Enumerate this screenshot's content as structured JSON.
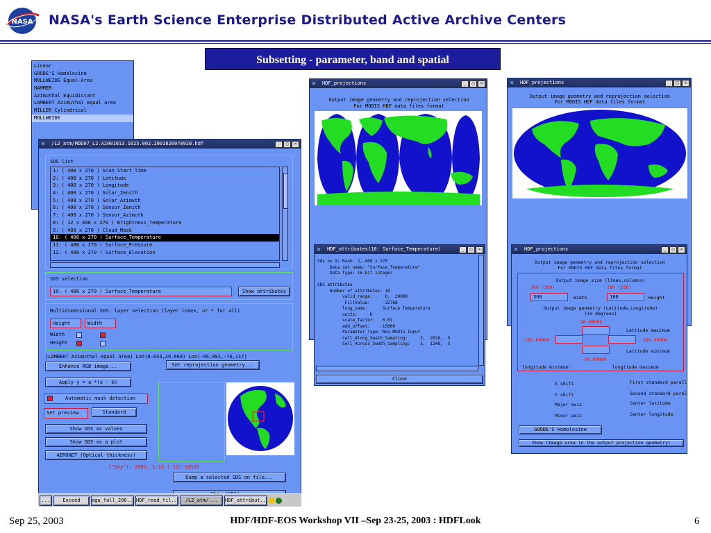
{
  "header": {
    "title": "NASA's Earth Science Enterprise Distributed Active Archive Centers",
    "logo_text": "NASA",
    "banner": "Subsetting - parameter, band and spatial"
  },
  "proj_list": {
    "items": [
      "Linear",
      "GOODE'S Homolosine",
      "MOLLWEIDE Equal-Area",
      "HAMMER",
      "Azimuthal Equidistant",
      "LAMBERT Azimuthal equal area",
      "MILLER Cylindrical",
      "MOLLWEIDE"
    ]
  },
  "main_window": {
    "title": "/L2_atm/MOD07_L2.A2001013.1625.002.2001026070928.hdf",
    "sds_list_label": "SDS  list",
    "sds_items": [
      "1: (  408 x  270 ) Scan_Start_Time",
      "2: (  408 x  270 ) Latitude",
      "3: (  408 x  270 ) Longitude",
      "4: (  408 x  270 ) Solar_Zenith",
      "5: (  408 x  270 ) Solar_Azimuth",
      "6: (  408 x  270 ) Sensor_Zenith",
      "7: (  408 x  270 ) Sensor_Azimuth",
      "8: (   12 x 408 x  270 ) Brightness_Temperature",
      "9: (  408 x  270 ) Cloud_Mask",
      "10: (  408 x  270 ) Surface_Temperature",
      "11: (  408 x  270 ) Surface_Pressure",
      "12: (  408 x  270 ) Surface_Elevation"
    ],
    "sds_selection_label": "SDS  selection",
    "sds_selection_value": "10: (  408 x  270 ) Surface_Temperature",
    "show_attributes": "Show attributes",
    "multidim_label": "Multidimensional SDS: layer selection (layer index, or * for all)",
    "height_field": "Height",
    "width_field": "Width",
    "width_row": "Width",
    "height_row": "Height",
    "lambert_line": "(LAMBERT Azimuthal equal area) Lat(8.653,29.669) Lon(-95,991,-70,117)",
    "enhance_btn": "Enhance RGB image...",
    "reprojection_btn": "Set reprojection geometry...",
    "apply_btn": "Apply   y = a *(x - b)",
    "auto_mask": "Automatic mask detection",
    "set_preview": "Set preview",
    "standard_btn": "Standard",
    "show_values": "Show SDS as values",
    "show_plot": "Show SDS as a plot",
    "aeronet": "AERONET (Optical thickness)",
    "day_line": "(\"Day\"): 2001: 1:13 ( 13) 16h25",
    "dump_btn": "Dump a selected SDS on file...",
    "more_btn": "Show (SDS)..."
  },
  "hdf_proj_1": {
    "title": "HDF_projections",
    "caption1": "Output image geometry and reprojection selection",
    "caption2": "For MODIS HDF data files format"
  },
  "hdf_proj_2": {
    "title": "HDF_projections",
    "caption1": "Output image geometry and reprojection selection",
    "caption2": "For MODIS HDF data files format"
  },
  "attr_window": {
    "title": "HDF_attributes(10: Surface_Temperature)",
    "lines": [
      "Sds no 9; Rank: 2, 408 x 270",
      "     Data set name: \"Surface_Temperature\"",
      "     Data type: 16-bit integer",
      "",
      "SDS attributes",
      "     Number of attributes: 10",
      "          valid_range:     0,  20000",
      "          _FillValue:     -32768",
      "          long_name:      Surface Temperature",
      "          units:     K",
      "          scale_factor:   0.01",
      "          add_offset:    -15000",
      "          Parameter_Type: Non MODIS Input",
      "          Cell_Along_Swath_Sampling:     3,  2028,  5",
      "          Cell_Across_Swath_Sampling:    3,  1348,  5"
    ],
    "close_btn": "Close"
  },
  "hdf_proj_3": {
    "title": "HDF_projections",
    "caption1": "Output image geometry and reprojection selection",
    "caption2": "For MODIS HDF data files format",
    "size_label": "Output image size (lines,columns)",
    "hint_left": "360 (360)",
    "hint_right": "180 (180)",
    "val_left": "360",
    "val_right": "180",
    "width_label": "Width",
    "height_label": "Height",
    "geom_label": "Output image geometry (Latitude,Longitude)",
    "degrees": "(in degrees)",
    "lat_max_val": "90,00000",
    "lat_max_label": "Latitude maximum",
    "lon_min_val": "-180,00000",
    "lon_max_val": "180,00000",
    "lat_min_label": "Latitude minimum",
    "lat_min_val": "-90,00000",
    "lon_min_label": "longitude minimum",
    "lon_max_label": "longitude maximum",
    "params": [
      [
        "X shift",
        "First standard paralle"
      ],
      [
        "Y shift",
        "Second standard parall"
      ],
      [
        "Major axis",
        "Center latitude"
      ],
      [
        "Minor axis",
        "Center longitude"
      ]
    ],
    "proj_btn": "GOODE'S Homolosine",
    "show_area": "Show (Image area in the output projection geometry)"
  },
  "taskbar": {
    "items": [
      "Exceed",
      "agu_fall_200...",
      "HDF_read_fil...",
      "/L2_atm/...",
      "HDF_attribut..."
    ],
    "start": "..."
  },
  "footer": {
    "date": "Sep 25, 2003",
    "center": "HDF/HDF-EOS Workshop VII –Sep 23-25, 2003 : HDFLook",
    "page": "6"
  },
  "colors": {
    "window_bg": "#6a94f4",
    "title_blue": "#1a1a8c",
    "banner_bg": "#1c1c9c",
    "land_green": "#22e022",
    "ocean_blue": "#1010d8"
  }
}
